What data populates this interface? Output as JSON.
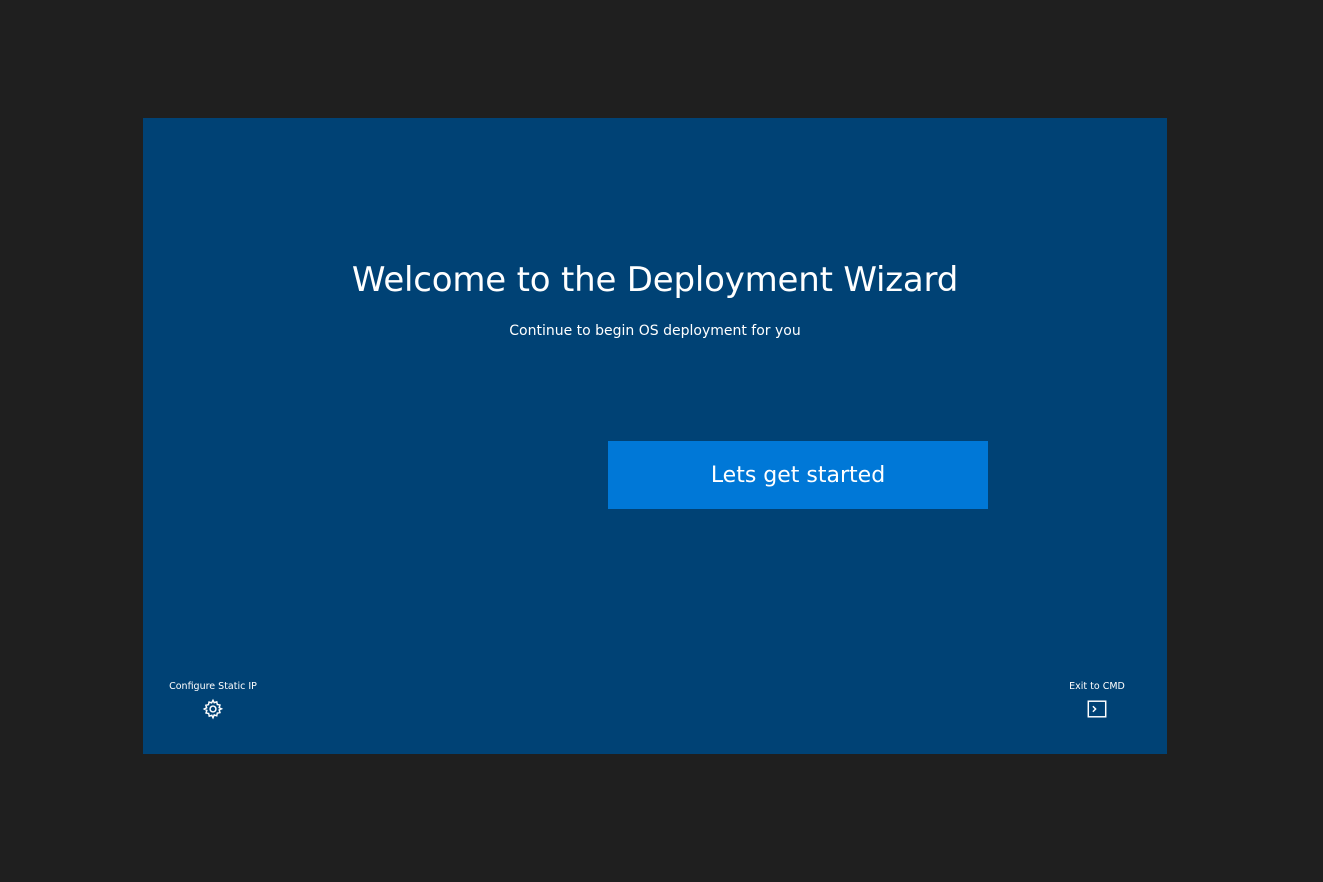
{
  "wizard": {
    "title": "Welcome to the Deployment Wizard",
    "subtitle": "Continue to begin OS deployment for you",
    "start_button_label": "Lets get started"
  },
  "footer": {
    "static_ip": {
      "label": "Configure Static IP",
      "icon": "gear-icon"
    },
    "exit_cmd": {
      "label": "Exit to CMD",
      "icon": "terminal-icon"
    }
  },
  "colors": {
    "backdrop": "#1f1f1f",
    "panel": "#004275",
    "accent_button": "#0078d7",
    "text": "#ffffff"
  }
}
